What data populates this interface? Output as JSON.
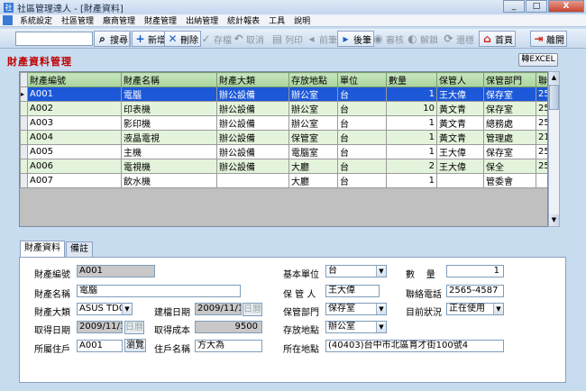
{
  "window": {
    "title": "社區管理達人 - [財產資料]"
  },
  "menu": [
    "系統設定",
    "社區管理",
    "廠商管理",
    "財產管理",
    "出納管理",
    "統計報表",
    "工具",
    "說明"
  ],
  "toolbar": {
    "search_value": "",
    "search": "搜尋",
    "add": "新增",
    "delete": "刪除",
    "save": "存檔",
    "cancel": "取消",
    "print": "列印",
    "prev": "前筆",
    "next": "後筆",
    "review": "審核",
    "unlock": "解鎖",
    "reset": "還穩",
    "home": "首頁",
    "exit": "離開"
  },
  "panel": {
    "title": "財產資料管理",
    "excel_label": "轉EXCEL"
  },
  "grid": {
    "columns": [
      "財產編號",
      "財產名稱",
      "財產大類",
      "存放地點",
      "單位",
      "數量",
      "保管人",
      "保管部門",
      "聯"
    ],
    "rows": [
      [
        "A001",
        "電腦",
        "辦公設備",
        "辦公室",
        "台",
        "1",
        "王大偉",
        "保存室",
        "25("
      ],
      [
        "A002",
        "印表機",
        "辦公設備",
        "辦公室",
        "台",
        "10",
        "黃文青",
        "保存室",
        "25("
      ],
      [
        "A003",
        "影印機",
        "辦公設備",
        "辦公室",
        "台",
        "1",
        "黃文青",
        "總務處",
        "25("
      ],
      [
        "A004",
        "液晶電視",
        "辦公設備",
        "保管室",
        "台",
        "1",
        "黃文青",
        "管理處",
        "21("
      ],
      [
        "A005",
        "主機",
        "辦公設備",
        "電腦室",
        "台",
        "1",
        "王大偉",
        "保存室",
        "25("
      ],
      [
        "A006",
        "電視機",
        "辦公設備",
        "大廳",
        "台",
        "2",
        "王大偉",
        "保全",
        "25("
      ],
      [
        "A007",
        "飲水機",
        "",
        "大廳",
        "台",
        "1",
        "",
        "管委會",
        ""
      ]
    ],
    "selected_row": 0
  },
  "tabs": [
    "財產資料",
    "備註"
  ],
  "form": {
    "asset_no_label": "財產編號",
    "asset_no": "A001",
    "asset_name_label": "財產名稱",
    "asset_name": "電腦",
    "category_label": "財產大類",
    "category": "ASUS TD0",
    "build_date_label": "建檔日期",
    "build_date": "2009/11/16",
    "acquire_date_label": "取得日期",
    "acquire_date": "2009/11/16",
    "date_btn": "日曆",
    "cost_label": "取得成本",
    "cost": "9500",
    "household_label": "所屬住戶",
    "household": "A001",
    "browse_btn": "瀏覽",
    "owner_label": "住戶名稱",
    "owner": "方大為",
    "unit_label": "基本單位",
    "unit": "台",
    "qty_label": "數    量",
    "qty": "1",
    "keeper_label": "保 管 人",
    "keeper": "王大偉",
    "phone_label": "聯絡電話",
    "phone": "2565-4587",
    "dept_label": "保管部門",
    "dept": "保存室",
    "status_label": "目前狀況",
    "status": "正在使用",
    "location_label": "存放地點",
    "location": "辦公室",
    "address_label": "所在地點",
    "address": "(40403)台中市北區育才街100號4"
  }
}
